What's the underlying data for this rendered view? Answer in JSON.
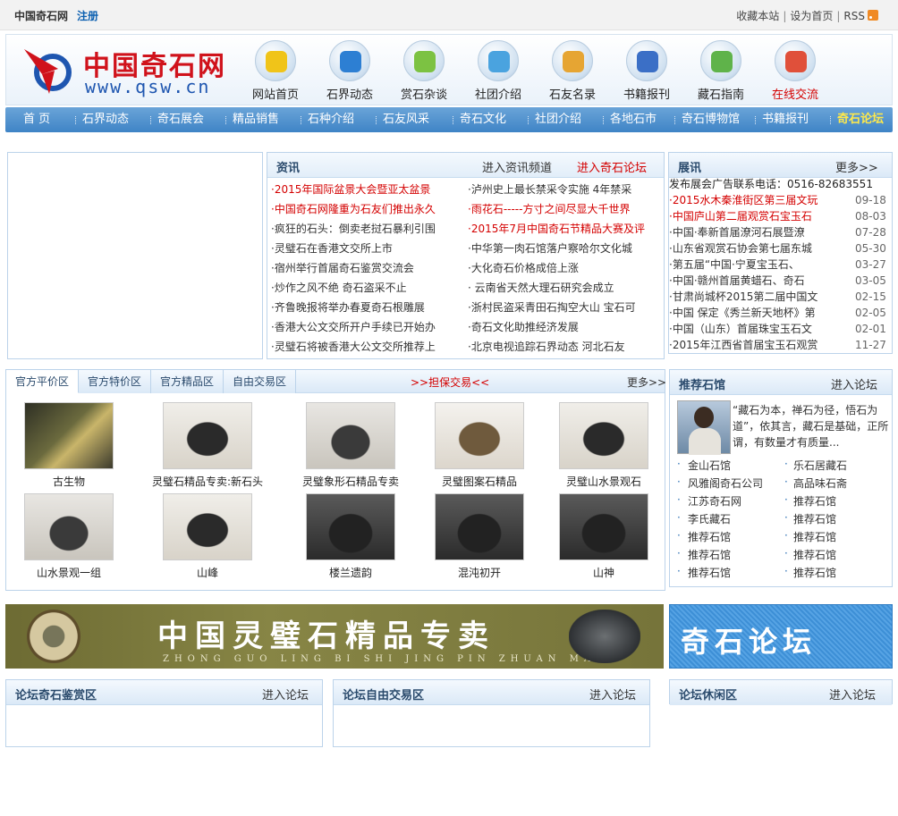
{
  "topbar": {
    "site_name": "中国奇石网",
    "register": "注册",
    "favorite": "收藏本站",
    "sethome": "设为首页",
    "rss": "RSS"
  },
  "header": {
    "logo_name": "中国奇石网",
    "logo_url": "www.qsw.cn",
    "icons": [
      {
        "label": "网站首页",
        "icon": "star-icon",
        "color": "#f0c419"
      },
      {
        "label": "石界动态",
        "icon": "ie-icon",
        "color": "#2d7fd3"
      },
      {
        "label": "赏石杂谈",
        "icon": "finder-icon",
        "color": "#7cc242"
      },
      {
        "label": "社团介绍",
        "icon": "users-icon",
        "color": "#4aa3df"
      },
      {
        "label": "石友名录",
        "icon": "picture-icon",
        "color": "#e6a533"
      },
      {
        "label": "书籍报刊",
        "icon": "book-icon",
        "color": "#3b6fc6"
      },
      {
        "label": "藏石指南",
        "icon": "chart-icon",
        "color": "#5fb34a"
      },
      {
        "label": "在线交流",
        "icon": "chat-icon",
        "color": "#e0503a"
      }
    ]
  },
  "nav": [
    "首 页",
    "石界动态",
    "奇石展会",
    "精品销售",
    "石种介绍",
    "石友风采",
    "奇石文化",
    "社团介绍",
    "各地石市",
    "奇石博物馆",
    "书籍报刊",
    "奇石论坛"
  ],
  "news": {
    "title": "资讯",
    "more1": "进入资讯频道",
    "more2": "进入奇石论坛",
    "left": [
      {
        "t": "·2015年国际盆景大会暨亚太盆景",
        "red": true
      },
      {
        "t": "·中国奇石网隆重为石友们推出永久",
        "red": true
      },
      {
        "t": "·疯狂的石头：倒卖老挝石暴利引围",
        "red": false
      },
      {
        "t": "·灵璧石在香港文交所上市",
        "red": false
      },
      {
        "t": "·宿州举行首届奇石鉴赏交流会",
        "red": false
      },
      {
        "t": "·炒作之风不绝 奇石盗采不止",
        "red": false
      },
      {
        "t": "·齐鲁晚报将举办春夏奇石根雕展",
        "red": false
      },
      {
        "t": "·香港大公文交所开户手续已开始办",
        "red": false
      },
      {
        "t": "·灵璧石将被香港大公文交所推荐上",
        "red": false
      }
    ],
    "right": [
      {
        "t": "·泸州史上最长禁采令实施 4年禁采",
        "red": false
      },
      {
        "t": "·雨花石-----方寸之间尽显大千世界",
        "red": true
      },
      {
        "t": "·2015年7月中国奇石节精品大赛及评",
        "red": true
      },
      {
        "t": "·中华第一肉石馆落户察哈尔文化城",
        "red": false
      },
      {
        "t": "·大化奇石价格成倍上涨",
        "red": false
      },
      {
        "t": "· 云南省天然大理石研究会成立",
        "red": false
      },
      {
        "t": "·浙村民盗采青田石掏空大山 宝石可",
        "red": false
      },
      {
        "t": "·奇石文化助推经济发展",
        "red": false
      },
      {
        "t": "·北京电视追踪石界动态 河北石友",
        "red": false
      }
    ]
  },
  "expo": {
    "title": "展讯",
    "more": "更多>>",
    "contact": "发布展会广告联系电话：0516-82683551",
    "items": [
      {
        "t": "·2015水木秦淮街区第三届文玩",
        "d": "09-18",
        "red": true
      },
      {
        "t": "·中国庐山第二届观赏石宝玉石",
        "d": "08-03",
        "red": true
      },
      {
        "t": "·中国·奉新首届潦河石展暨潦",
        "d": "07-28",
        "red": false
      },
      {
        "t": "·山东省观赏石协会第七届东城",
        "d": "05-30",
        "red": false
      },
      {
        "t": "·第五届“中国·宁夏宝玉石、",
        "d": "03-27",
        "red": false
      },
      {
        "t": "·中国·赣州首届黄蜡石、奇石",
        "d": "03-05",
        "red": false
      },
      {
        "t": "·甘肃尚城杯2015第二届中国文",
        "d": "02-15",
        "red": false
      },
      {
        "t": "·中国 保定《秀兰新天地杯》第",
        "d": "02-05",
        "red": false
      },
      {
        "t": "·中国（山东）首届珠宝玉石文",
        "d": "02-01",
        "red": false
      },
      {
        "t": "·2015年江西省首届宝玉石观赏",
        "d": "11-27",
        "red": false
      }
    ]
  },
  "market": {
    "tabs": [
      "官方平价区",
      "官方特价区",
      "官方精品区",
      "自由交易区"
    ],
    "escrow": ">>担保交易<<",
    "more": "更多>>",
    "row1": [
      "古生物",
      "灵璧石精品专卖:新石头",
      "灵璧象形石精品专卖",
      "灵璧图案石精品",
      "灵璧山水景观石"
    ],
    "row2": [
      "山水景观一组",
      "山峰",
      "楼兰遗韵",
      "混沌初开",
      "山神"
    ]
  },
  "recommend": {
    "title": "推荐石馆",
    "more": "进入论坛",
    "intro": "“藏石为本，禅石为径，悟石为道”，依其言，藏石是基础，正所谓，有数量才有质量...",
    "links_left": [
      "金山石馆",
      "风雅阁奇石公司",
      "江苏奇石网",
      "李氏藏石",
      "推荐石馆",
      "推荐石馆",
      "推荐石馆"
    ],
    "links_right": [
      "乐石居藏石",
      "高品味石斋",
      "推荐石馆",
      "推荐石馆",
      "推荐石馆",
      "推荐石馆",
      "推荐石馆"
    ]
  },
  "banners": {
    "main_title": "中国灵璧石精品专卖",
    "main_pinyin": "ZHONG GUO LING BI SHI JING PIN ZHUAN MAI",
    "forum_title": "奇石论坛"
  },
  "forums": [
    {
      "title": "论坛奇石鉴赏区",
      "more": "进入论坛"
    },
    {
      "title": "论坛自由交易区",
      "more": "进入论坛"
    },
    {
      "title": "论坛休闲区",
      "more": "进入论坛"
    }
  ]
}
